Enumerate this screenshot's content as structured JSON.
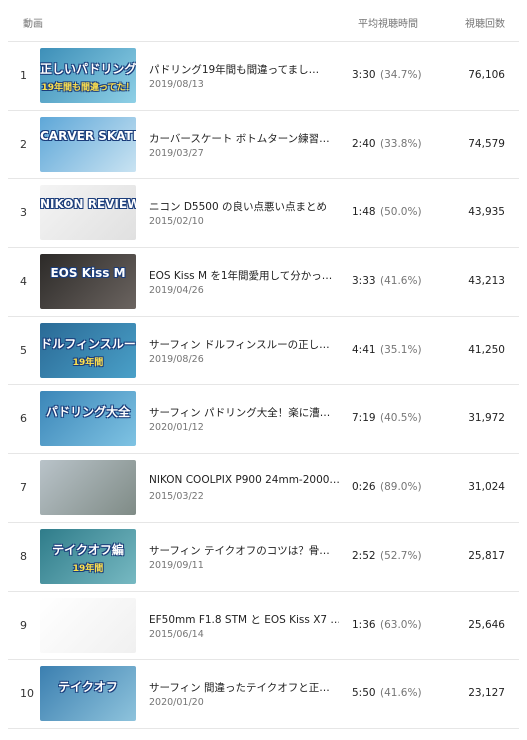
{
  "header": {
    "video": "動画",
    "avg_duration": "平均視聴時間",
    "views": "視聴回数"
  },
  "rows": [
    {
      "rank": "1",
      "title": "パドリング19年間も間違ってまし…",
      "date": "2019/08/13",
      "avg": "3:30",
      "pct": "(34.7%)",
      "views": "76,106",
      "thumb": {
        "cap1": "正しいパドリング",
        "cap2": "19年間も間違ってた！",
        "bg1": "#3d8fb8",
        "bg2": "#8fd0e6"
      }
    },
    {
      "rank": "2",
      "title": "カーバースケート ボトムターン練習…",
      "date": "2019/03/27",
      "avg": "2:40",
      "pct": "(33.8%)",
      "views": "74,579",
      "thumb": {
        "cap1": "CARVER SKATE",
        "cap2": "",
        "bg1": "#5ea7d8",
        "bg2": "#c9e3f2"
      }
    },
    {
      "rank": "3",
      "title": "ニコン D5500 の良い点悪い点まとめ",
      "date": "2015/02/10",
      "avg": "1:48",
      "pct": "(50.0%)",
      "views": "43,935",
      "thumb": {
        "cap1": "NIKON  REVIEW",
        "cap2": "",
        "bg1": "#f4f4f4",
        "bg2": "#e0e0e0"
      }
    },
    {
      "rank": "4",
      "title": "EOS Kiss M を1年間愛用して分かっ…",
      "date": "2019/04/26",
      "avg": "3:33",
      "pct": "(41.6%)",
      "views": "43,213",
      "thumb": {
        "cap1": "EOS Kiss M",
        "cap2": "",
        "bg1": "#2c2a28",
        "bg2": "#6b6460"
      }
    },
    {
      "rank": "5",
      "title": "サーフィン ドルフィンスルーの正し…",
      "date": "2019/08/26",
      "avg": "4:41",
      "pct": "(35.1%)",
      "views": "41,250",
      "thumb": {
        "cap1": "ドルフィンスルー",
        "cap2": "19年間",
        "bg1": "#2a6a96",
        "bg2": "#4aa0c8"
      }
    },
    {
      "rank": "6",
      "title": "サーフィン パドリング大全！楽に漕…",
      "date": "2020/01/12",
      "avg": "7:19",
      "pct": "(40.5%)",
      "views": "31,972",
      "thumb": {
        "cap1": "パドリング大全",
        "cap2": "",
        "bg1": "#3b86b8",
        "bg2": "#7fc3e3"
      }
    },
    {
      "rank": "7",
      "title": "NIKON COOLPIX P900 24mm-2000…",
      "date": "2015/03/22",
      "avg": "0:26",
      "pct": "(89.0%)",
      "views": "31,024",
      "thumb": {
        "cap1": "",
        "cap2": "",
        "bg1": "#b9c3c9",
        "bg2": "#7f8b86"
      }
    },
    {
      "rank": "8",
      "title": "サーフィン テイクオフのコツは？骨…",
      "date": "2019/09/11",
      "avg": "2:52",
      "pct": "(52.7%)",
      "views": "25,817",
      "thumb": {
        "cap1": "テイクオフ編",
        "cap2": "19年間",
        "bg1": "#2f7c8a",
        "bg2": "#77b9c2"
      }
    },
    {
      "rank": "9",
      "title": "EF50mm F1.8 STM と EOS Kiss X7 …",
      "date": "2015/06/14",
      "avg": "1:36",
      "pct": "(63.0%)",
      "views": "25,646",
      "thumb": {
        "cap1": "",
        "cap2": "",
        "bg1": "#ffffff",
        "bg2": "#f0f0f0"
      }
    },
    {
      "rank": "10",
      "title": "サーフィン 間違ったテイクオフと正…",
      "date": "2020/01/20",
      "avg": "5:50",
      "pct": "(41.6%)",
      "views": "23,127",
      "thumb": {
        "cap1": "テイクオフ",
        "cap2": "",
        "bg1": "#3b7fb0",
        "bg2": "#8ec3dc"
      }
    }
  ]
}
